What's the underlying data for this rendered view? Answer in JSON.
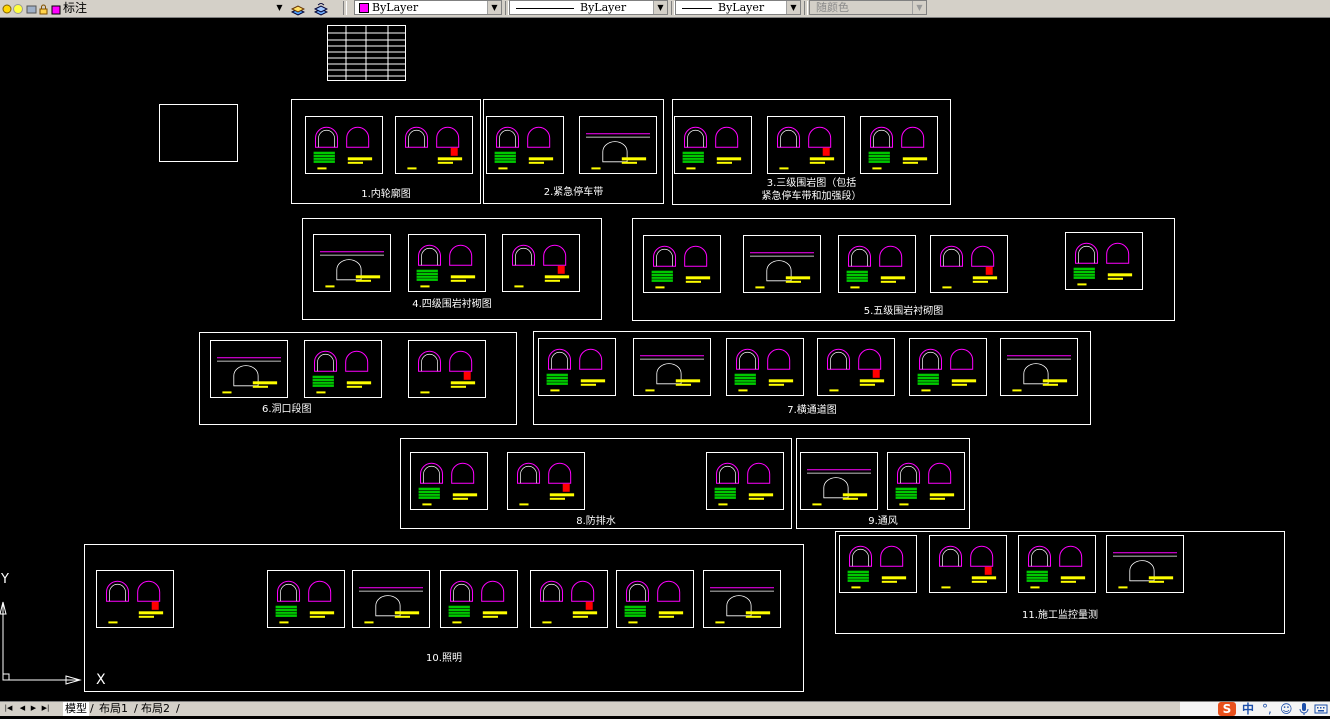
{
  "toolbar": {
    "layer_name": "标注",
    "color_value": "ByLayer",
    "linetype_value": "ByLayer",
    "lineweight_value": "ByLayer",
    "plotstyle_value": "随颜色",
    "colors": {
      "layer_swatch": "#ff00ff",
      "toolbar_bg": "#d4d0c8"
    }
  },
  "drawing": {
    "background": "#000000",
    "groups": [
      {
        "caption": "1.内轮廓图",
        "sheets": 2
      },
      {
        "caption": "2.紧急停车带",
        "sheets": 2
      },
      {
        "caption": "3.三级围岩图（包括",
        "caption2": "紧急停车带和加强段）",
        "sheets": 3
      },
      {
        "caption": "4.四级围岩衬砌图",
        "sheets": 3
      },
      {
        "caption": "5.五级围岩衬砌图",
        "sheets": 5
      },
      {
        "caption": "6.洞口段图",
        "sheets": 3
      },
      {
        "caption": "7.横通道图",
        "sheets": 6
      },
      {
        "caption": "8.防排水",
        "sheets": 3
      },
      {
        "caption": "9.通风",
        "sheets": 2
      },
      {
        "caption": "10.照明",
        "sheets": 7
      },
      {
        "caption": "11.施工监控量测",
        "sheets": 4
      }
    ],
    "ucs": {
      "x_label": "X",
      "y_label": "Y"
    }
  },
  "layout_tabs": {
    "items": [
      "模型",
      "布局1",
      "布局2"
    ],
    "active": "模型"
  },
  "ime": {
    "logo": "S",
    "mode": "中",
    "punct": "°,",
    "emoji": "☺",
    "mic": "mic-icon",
    "keyboard": "keyboard-icon"
  }
}
